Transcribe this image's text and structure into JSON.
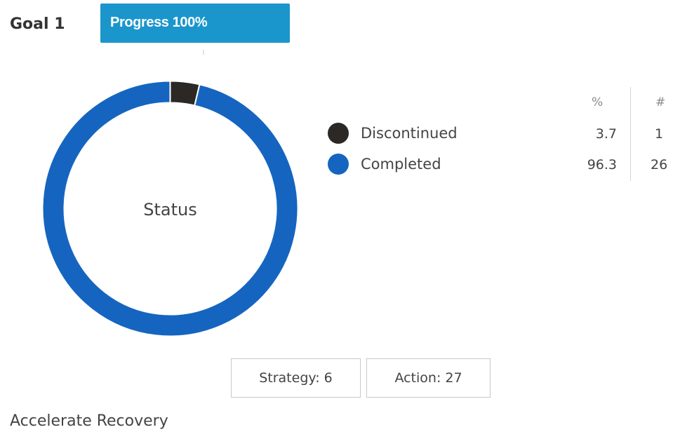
{
  "goal": {
    "title": "Goal 1",
    "progress_label": "Progress 100%",
    "progress_percent": 100,
    "name": "Accelerate Recovery"
  },
  "colors": {
    "progress_badge": "#1a96cc",
    "discontinued": "#2b2825",
    "completed": "#1565c0"
  },
  "chart_data": {
    "type": "pie",
    "center_label": "Status",
    "legend_placement": "right",
    "column_headers": [
      "%",
      "#"
    ],
    "series": [
      {
        "name": "Discontinued",
        "percent": 3.7,
        "count": 1,
        "percent_label": "3.7",
        "count_label": "1"
      },
      {
        "name": "Completed",
        "percent": 96.3,
        "count": 26,
        "percent_label": "96.3",
        "count_label": "26"
      }
    ]
  },
  "counts": {
    "strategy_label": "Strategy: 6",
    "action_label": "Action: 27"
  }
}
